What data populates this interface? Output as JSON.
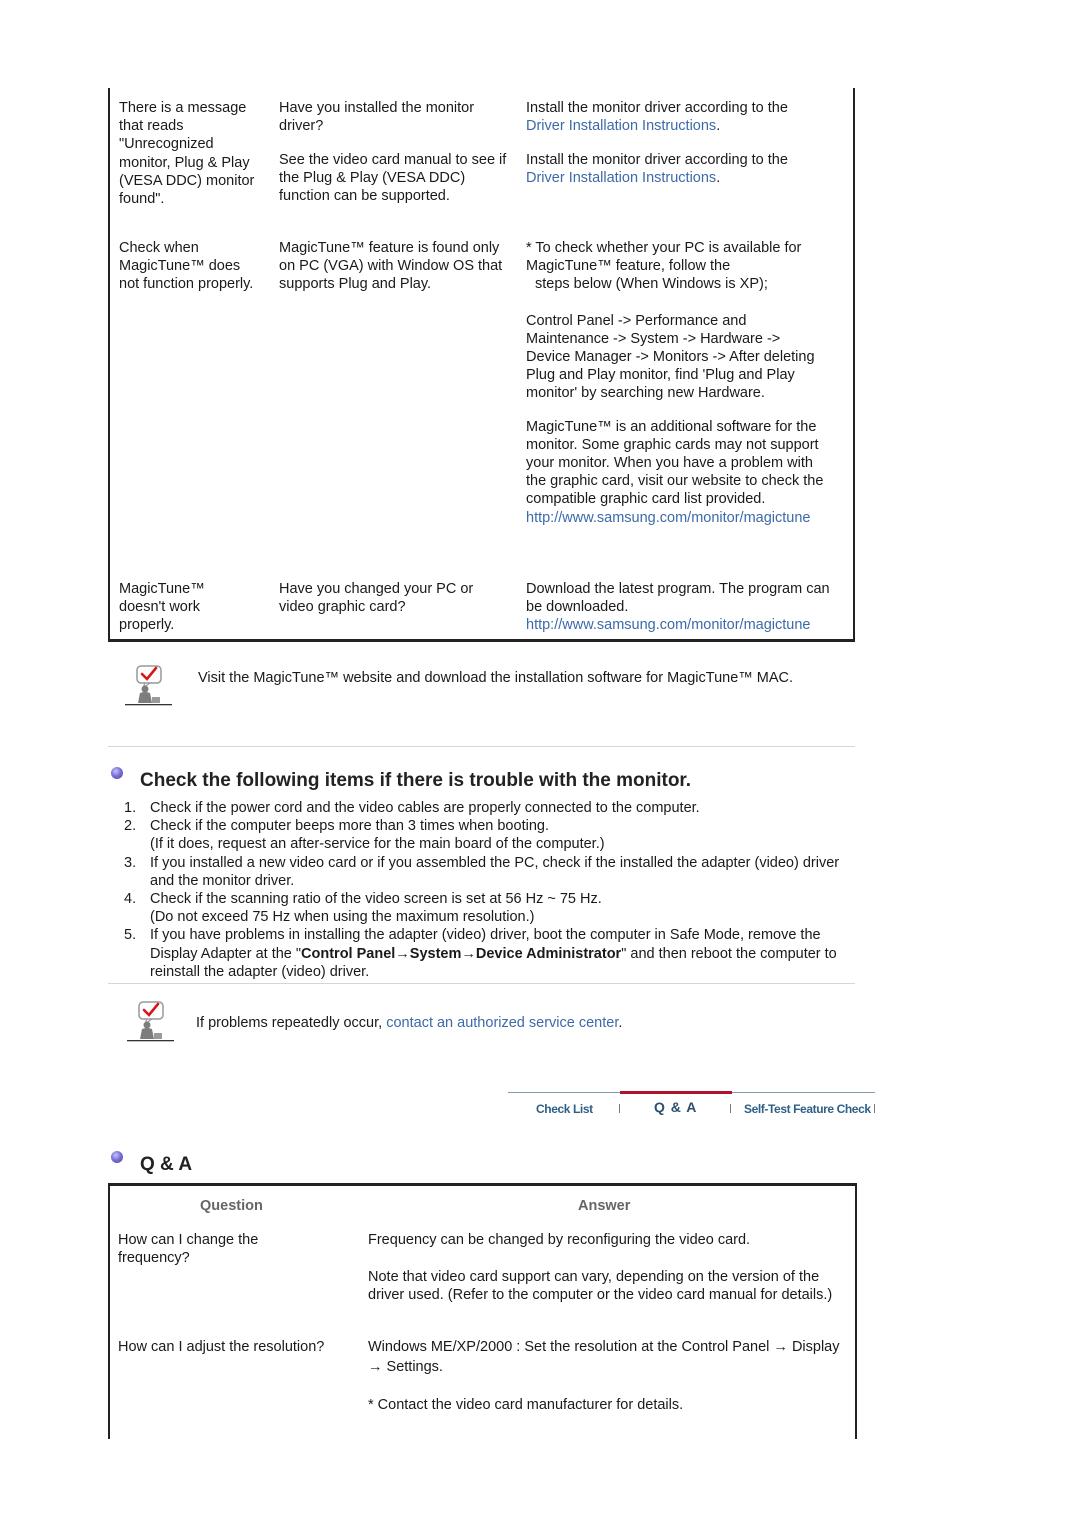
{
  "troubleshoot_table": {
    "rows": [
      {
        "symptom": "There is a message that reads \"Unrecognized monitor, Plug & Play (VESA DDC) monitor found\".",
        "checks": [
          {
            "check": "Have you installed the monitor driver?",
            "solution_text": "Install the monitor driver according to the",
            "solution_link": "Driver Installation Instructions",
            "solution_suffix": "."
          },
          {
            "check": "See the video card manual to see if the Plug & Play (VESA DDC) function can be supported.",
            "solution_text": "Install the monitor driver according to the",
            "solution_link": "Driver Installation Instructions",
            "solution_suffix": "."
          }
        ]
      },
      {
        "symptom": "Check when MagicTune™ does not function properly.",
        "check": "MagicTune™ feature is found only on PC (VGA) with Window OS that supports Plug and Play.",
        "solution_para1_line1": "* To check whether your PC is available for MagicTune™ feature, follow the",
        "solution_para1_line2": "steps below (When Windows is XP);",
        "solution_para2": "Control Panel -> Performance and Maintenance -> System -> Hardware -> Device Manager -> Monitors -> After deleting Plug and Play monitor, find 'Plug and Play monitor' by searching new Hardware.",
        "solution_para3": "MagicTune™ is an additional software for the monitor. Some graphic cards may not support your monitor. When you have a problem with the graphic card, visit our website to check the compatible graphic card list provided.",
        "solution_link": "http://www.samsung.com/monitor/magictune"
      },
      {
        "symptom": "MagicTune™ doesn't work properly.",
        "check": "Have you changed your PC or video graphic card?",
        "solution_text": "Download the latest program. The program can be downloaded.",
        "solution_link": "http://www.samsung.com/monitor/magictune"
      }
    ]
  },
  "note_magictune_mac": {
    "icon": "check-note-icon",
    "text": "Visit the MagicTune™ website and download the installation software for MagicTune™ MAC."
  },
  "trouble_section": {
    "title": "Check the following items if there is trouble with the monitor.",
    "steps": [
      {
        "num": "1.",
        "text": "Check if the power cord and the video cables are properly connected to the computer."
      },
      {
        "num": "2.",
        "text": "Check if the computer beeps more than 3 times when booting.",
        "sub": "(If it does, request an after-service for the main board of the computer.)"
      },
      {
        "num": "3.",
        "text": "If you installed a new video card or if you assembled the PC, check if the installed the adapter (video) driver and the monitor driver."
      },
      {
        "num": "4.",
        "text": "Check if the scanning ratio of the video screen is set at 56 Hz ~ 75 Hz.",
        "sub": "(Do not exceed 75 Hz when using the maximum resolution.)"
      },
      {
        "num": "5.",
        "text_before": "If you have problems in installing the adapter (video) driver, boot the computer in Safe Mode, remove the Display Adapter at the \"",
        "bold_path": "Control Panel→System→Device Administrator",
        "text_after": "\" and then reboot the computer to reinstall the adapter (video) driver."
      }
    ]
  },
  "note_service": {
    "icon": "check-note-icon",
    "text": "If problems repeatedly occur,",
    "link": "contact an authorized service center",
    "suffix": "."
  },
  "nav_tabs": {
    "items": [
      {
        "label": "Check List",
        "active": false
      },
      {
        "label": "Q & A",
        "active": true
      },
      {
        "label": "Self-Test Feature Check",
        "active": false
      }
    ],
    "active_color": "#b0132e",
    "label_color": "#2e5f86"
  },
  "qa_section": {
    "title": "Q & A",
    "headers": {
      "question": "Question",
      "answer": "Answer"
    },
    "rows": [
      {
        "question": "How can I change the frequency?",
        "answer_para1": "Frequency can be changed by reconfiguring the video card.",
        "answer_para2": "Note that video card support can vary, depending on the version of the driver used. (Refer to the computer or the video card manual for details.)"
      },
      {
        "question": "How can I adjust the resolution?",
        "answer_para1": "Windows ME/XP/2000 : Set the resolution at the Control Panel → Display → Settings.",
        "answer_para2": "* Contact the video card manufacturer for details."
      }
    ]
  },
  "colors": {
    "link": "#3c6aa8",
    "text": "#1a1a1a",
    "table_border": "#222222",
    "header_gray": "#666666"
  }
}
